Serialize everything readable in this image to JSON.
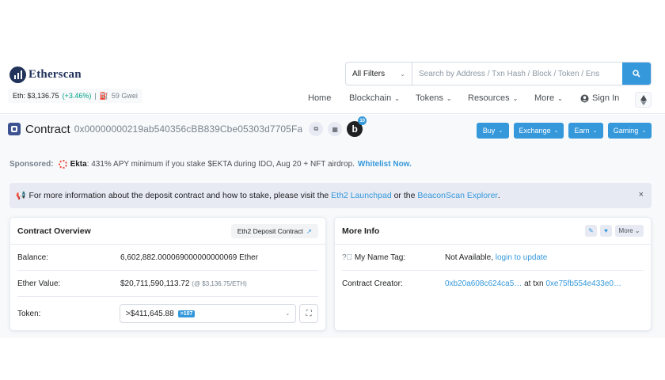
{
  "header": {
    "logo_text": "Etherscan",
    "eth_price_label": "Eth: $3,136.75",
    "eth_change": "(+3.46%)",
    "separator": "|",
    "gas": "59 Gwei",
    "filter_label": "All Filters",
    "search_placeholder": "Search by Address / Txn Hash / Block / Token / Ens",
    "nav": {
      "home": "Home",
      "blockchain": "Blockchain",
      "tokens": "Tokens",
      "resources": "Resources",
      "more": "More",
      "sign_in": "Sign In"
    }
  },
  "title_bar": {
    "title": "Contract",
    "address": "0x00000000219ab540356cBB839Cbe05303d7705Fa",
    "badge_letter": "b",
    "badge_count": "10",
    "buttons": {
      "buy": "Buy",
      "exchange": "Exchange",
      "earn": "Earn",
      "gaming": "Gaming"
    }
  },
  "sponsored": {
    "label": "Sponsored:",
    "name": "Ekta",
    "text": ": 431% APY minimum if you stake $EKTA during IDO, Aug 20 + NFT airdrop.",
    "cta": "Whitelist Now."
  },
  "alert": {
    "text_before": "For more information about the deposit contract and how to stake, please visit the",
    "link1": "Eth2 Launchpad",
    "text_mid": "or the",
    "link2": "BeaconScan Explorer",
    "text_end": ".",
    "close": "×"
  },
  "overview": {
    "title": "Contract Overview",
    "tag": "Eth2 Deposit Contract",
    "balance_label": "Balance:",
    "balance_value": "6,602,882.000069000000000069 Ether",
    "ether_value_label": "Ether Value:",
    "ether_value": "$20,711,590,113.72",
    "ether_value_note": "(@ $3,136.75/ETH)",
    "token_label": "Token:",
    "token_value": ">$411,645.88",
    "token_count": ">107"
  },
  "more_info": {
    "title": "More Info",
    "more_label": "More",
    "name_tag_label": "My Name Tag:",
    "name_tag_value": "Not Available,",
    "name_tag_link": "login to update",
    "creator_label": "Contract Creator:",
    "creator_address": "0xb20a608c624ca5…",
    "creator_at": "at txn",
    "creator_txn": "0xe75fb554e433e0…"
  }
}
